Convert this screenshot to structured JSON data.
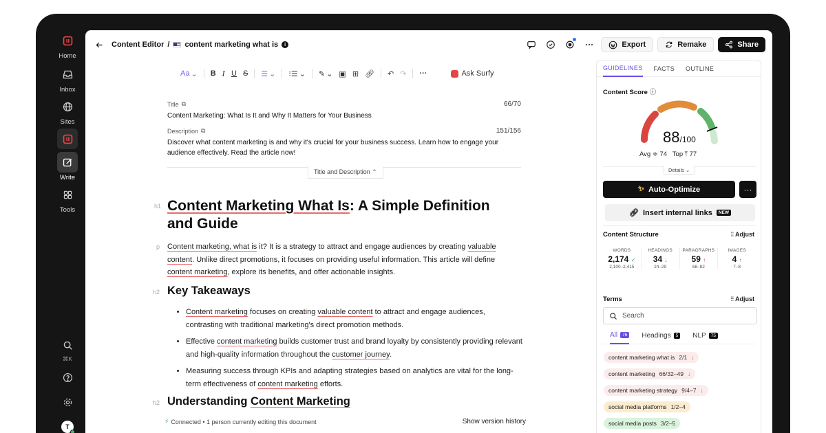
{
  "rail": {
    "items": [
      {
        "label": "Home"
      },
      {
        "label": "Inbox"
      },
      {
        "label": "Sites"
      },
      {
        "label": "Write"
      },
      {
        "label": "Tools"
      }
    ],
    "kbd": "⌘K",
    "avatar_initial": "T"
  },
  "topbar": {
    "breadcrumb_root": "Content Editor",
    "separator": "/",
    "doc_name": "content marketing what is",
    "export_label": "Export",
    "remake_label": "Remake",
    "share_label": "Share"
  },
  "toolbar": {
    "font_label": "Aa",
    "ask_label": "Ask Surfy"
  },
  "meta": {
    "title_label": "Title",
    "title_count": "66/70",
    "title_text": "Content Marketing: What Is It and Why It Matters for Your Business",
    "desc_label": "Description",
    "desc_count": "151/156",
    "desc_text": "Discover what content marketing is and why it's crucial for your business success. Learn how to engage your audience effectively. Read the article now!",
    "toggle_label": "Title and Description"
  },
  "content": {
    "h1_tag": "h1",
    "h1_line1": "Content Marketing What Is",
    "h1_line1_rest": ": A Simple Definition",
    "h1_line2": "and Guide",
    "p_tag": "p",
    "para": {
      "s1": "Content marketing, what is",
      "s2": " it? It is a strategy to attract and engage audiences by creating ",
      "s3": "valuable content",
      "s4": ". Unlike direct promotions, it focuses on providing useful information. This article will define ",
      "s5": "content marketing",
      "s6": ", explore its benefits, and offer actionable insights."
    },
    "h2_tag": "h2",
    "h2_key": "Key Takeaways",
    "bullets": [
      {
        "a": "Content marketing",
        "b": " focuses on creating ",
        "c": "valuable content",
        "d": " to attract and engage audiences, contrasting with traditional marketing's direct promotion methods."
      },
      {
        "a": "Effective ",
        "b": "content marketing",
        "c": " builds customer trust and brand loyalty by consistently providing relevant and high-quality information throughout the ",
        "d": "customer journey",
        "e": "."
      },
      {
        "a": "Measuring success through KPIs and adapting strategies based on analytics are vital for the long-term effectiveness of ",
        "b": "content marketing",
        "c": " efforts."
      }
    ],
    "h2_tag2": "h2",
    "h2_under_a": "Understanding ",
    "h2_under_b": "Content Marketing"
  },
  "status": {
    "connected": "Connected",
    "editing": "• 1 person currently editing this document",
    "history": "Show version history"
  },
  "panel": {
    "tabs": [
      "GUIDELINES",
      "FACTS",
      "OUTLINE"
    ],
    "score_title": "Content Score",
    "score_value": "88",
    "score_max": "/100",
    "avg_label": "Avg",
    "avg_value": "74",
    "top_label": "Top",
    "top_value": "77",
    "details_label": "Details",
    "auto_label": "Auto-Optimize",
    "more_label": "···",
    "insert_label": "Insert internal links",
    "new_badge": "NEW",
    "structure_title": "Content Structure",
    "adjust_label": "Adjust",
    "stats": [
      {
        "label": "WORDS",
        "value": "2,174",
        "mark": "✓",
        "range": "2,100–2,415"
      },
      {
        "label": "HEADINGS",
        "value": "34",
        "mark": "↓",
        "range": "24–29"
      },
      {
        "label": "PARAGRAPHS",
        "value": "59",
        "mark": "↑",
        "range": "68–82"
      },
      {
        "label": "IMAGES",
        "value": "4",
        "mark": "↑",
        "range": "7–8"
      }
    ],
    "terms_title": "Terms",
    "search_placeholder": "Search",
    "term_tabs": [
      {
        "label": "All",
        "count": "76"
      },
      {
        "label": "Headings",
        "count": "5"
      },
      {
        "label": "NLP",
        "count": "75"
      }
    ],
    "terms": [
      {
        "text": "content marketing what is",
        "value": "2/1",
        "mark": "↓"
      },
      {
        "text": "content marketing",
        "value": "66/32–49",
        "mark": "↓"
      },
      {
        "text": "content marketing strategy",
        "value": "9/4–7",
        "mark": "↓"
      },
      {
        "text": "social media platforms",
        "value": "1/2–4",
        "mark": ""
      },
      {
        "text": "social media posts",
        "value": "3/2–5",
        "mark": ""
      }
    ],
    "gauge_score": 88,
    "gauge_colors": {
      "red": "#d9463f",
      "orange": "#e08c3a",
      "green": "#5fb36a",
      "pale": "#cfe8d2"
    }
  }
}
